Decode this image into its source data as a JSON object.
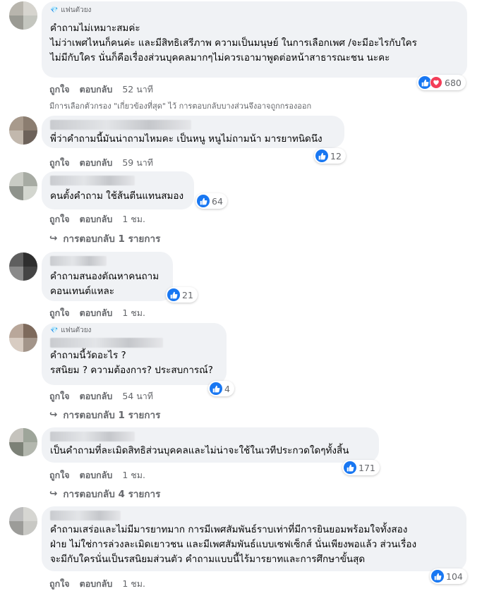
{
  "labels": {
    "like": "ถูกใจ",
    "reply": "ตอบกลับ",
    "fan_badge": "แฟนตัวยง"
  },
  "colors": {
    "like_blue": "#1877f2",
    "love_red": "#f33e58",
    "bubble_bg": "#f0f2f5",
    "meta_gray": "#65676b"
  },
  "filter_note": "มีการเลือกตัวกรอง \"เกี่ยวข้องที่สุด\" ไว้ การตอบกลับบางส่วนจึงอาจถูกกรองออก",
  "comments": [
    {
      "text": "คำถามไม่เหมาะสมค่ะ\nไม่ว่าเพศไหนก็คนค่ะ และมีสิทธิเสรีภาพ ความเป็นมนุษย์ ในการเลือกเพศ /จะมีอะไรกับใคร\nไม่มีกับใคร นั่นก็คือเรื่องส่วนบุคคลมากๆไม่ควรเอามาพูดต่อหน้าสาธารณะชน นะคะ",
      "reactions": "680",
      "time": "52 นาที",
      "reaction_types": [
        "like-icon",
        "love-icon"
      ]
    },
    {
      "text": "พี่ว่าคำถามนี้มันน่าถามไหมคะ เป็นหนู หนูไม่ถามน้า มารยาทนิดนึง",
      "reactions": "12",
      "time": "59 นาที"
    },
    {
      "text": "คนตั้งคำถาม ใช้ส้นตีนแทนสมอง",
      "reactions": "64",
      "time": "1 ชม.",
      "replies": "การตอบกลับ 1 รายการ"
    },
    {
      "text": "คำถามสนองตัณหาคนถาม\nคอนเทนต์แหละ",
      "reactions": "21",
      "time": "1 ชม."
    },
    {
      "text": "คำถามนี้วัดอะไร ?\nรสนิยม ? ความต้องการ? ประสบการณ์?",
      "reactions": "4",
      "time": "54 นาที",
      "replies": "การตอบกลับ 1 รายการ"
    },
    {
      "text": "เป็นคำถามที่ละเมิดสิทธิส่วนบุคคลและไม่น่าจะใช้ในเวทีประกวดใดๆทั้งสิ้น",
      "reactions": "171",
      "time": "1 ชม.",
      "replies": "การตอบกลับ 4 รายการ"
    },
    {
      "text": "คำถามเสร่อและไม่มีมารยาทมาก การมีเพศสัมพันธ์ราบเท่าที่มีการยินยอมพร้อมใจทั้งสอง\nฝ่าย ไม่ใช่การล่วงละเมิดเยาวชน และมีเพศสัมพันธ์แบบเซฟเซ็กส์ นั่นเพียงพอแล้ว ส่วนเรื่อง\nจะมีกับใครนั่นเป็นรสนิยมส่วนตัว คำถามแบบนี้ไร้มารยาทและการศึกษาขั้นสุด",
      "reactions": "104",
      "time": "1 ชม."
    }
  ]
}
